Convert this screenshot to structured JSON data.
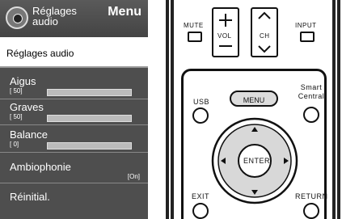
{
  "osd": {
    "title": "Réglages audio",
    "menu_label": "Menu",
    "subheader": "Réglages audio",
    "items": [
      {
        "label": "Aigus",
        "value": "[ 50]"
      },
      {
        "label": "Graves",
        "value": "[ 50]"
      },
      {
        "label": "Balance",
        "value": "[ 0]"
      },
      {
        "label": "Ambiophonie",
        "tag": "[On]"
      },
      {
        "label": "Réinitial."
      }
    ]
  },
  "remote": {
    "mute": "MUTE",
    "vol": "VOL",
    "ch": "CH",
    "input": "INPUT",
    "smart_central": "Smart Central",
    "usb": "USB",
    "menu": "MENU",
    "enter": "ENTER",
    "exit": "EXIT",
    "return": "RETURN"
  }
}
